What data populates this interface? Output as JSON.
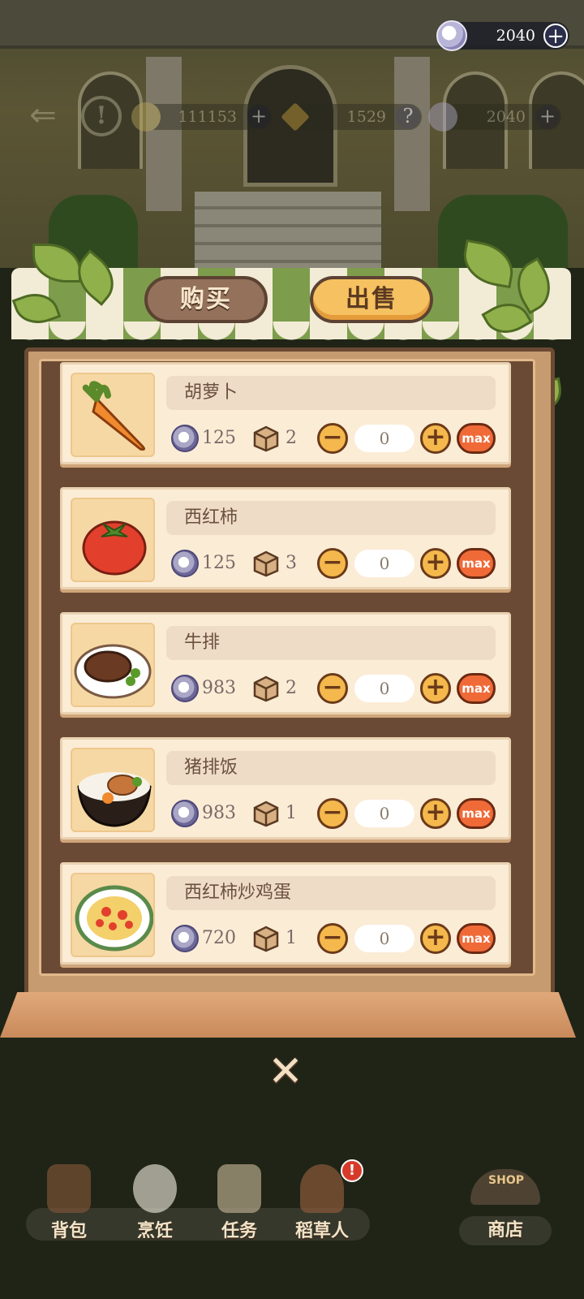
{
  "colors": {
    "accent": "#f6c160",
    "max": "#f06a38",
    "panel": "#c79b70"
  },
  "top_bar": {
    "coins": "2040"
  },
  "underlay": {
    "gold": "111153",
    "gems": "1529",
    "coins": "2040"
  },
  "tabs": {
    "buy": "购买",
    "sell": "出售",
    "active": "sell"
  },
  "items": [
    {
      "name": "胡萝卜",
      "price": "125",
      "stock": "2",
      "qty": "0",
      "icon": "carrot-icon"
    },
    {
      "name": "西红柿",
      "price": "125",
      "stock": "3",
      "qty": "0",
      "icon": "tomato-icon"
    },
    {
      "name": "牛排",
      "price": "983",
      "stock": "2",
      "qty": "0",
      "icon": "steak-icon"
    },
    {
      "name": "猪排饭",
      "price": "983",
      "stock": "1",
      "qty": "0",
      "icon": "pork-rice-icon"
    },
    {
      "name": "西红柿炒鸡蛋",
      "price": "720",
      "stock": "1",
      "qty": "0",
      "icon": "tomato-egg-icon"
    }
  ],
  "buttons": {
    "minus": "−",
    "plus": "+",
    "max": "max",
    "close": "✕"
  },
  "dock": {
    "bag": "背包",
    "cook": "烹饪",
    "task": "任务",
    "scarecrow": "稻草人",
    "shop": "商店",
    "shop_sign": "SHOP",
    "alert": "!"
  }
}
